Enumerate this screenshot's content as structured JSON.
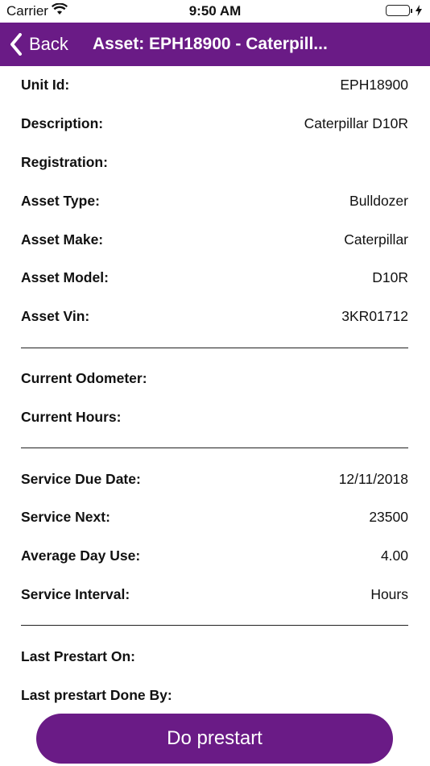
{
  "status": {
    "carrier": "Carrier",
    "time": "9:50 AM"
  },
  "nav": {
    "back_label": "Back",
    "title": "Asset: EPH18900 - Caterpill..."
  },
  "sections": [
    [
      {
        "label": "Unit Id:",
        "value": "EPH18900"
      },
      {
        "label": "Description:",
        "value": "Caterpillar D10R"
      },
      {
        "label": "Registration:",
        "value": ""
      },
      {
        "label": "Asset Type:",
        "value": "Bulldozer"
      },
      {
        "label": "Asset Make:",
        "value": "Caterpillar"
      },
      {
        "label": "Asset Model:",
        "value": "D10R"
      },
      {
        "label": "Asset Vin:",
        "value": "3KR01712"
      }
    ],
    [
      {
        "label": "Current Odometer:",
        "value": ""
      },
      {
        "label": "Current Hours:",
        "value": ""
      }
    ],
    [
      {
        "label": "Service Due Date:",
        "value": "12/11/2018"
      },
      {
        "label": "Service Next:",
        "value": "23500"
      },
      {
        "label": "Average Day Use:",
        "value": "4.00"
      },
      {
        "label": "Service Interval:",
        "value": "Hours"
      }
    ],
    [
      {
        "label": "Last Prestart On:",
        "value": ""
      },
      {
        "label": "Last prestart Done By:",
        "value": ""
      }
    ]
  ],
  "action": {
    "label": "Do prestart"
  },
  "colors": {
    "accent": "#6a1b86",
    "battery": "#4cd964"
  },
  "icons": {
    "back": "chevron-left-icon",
    "wifi": "wifi-icon",
    "battery": "battery-icon",
    "charging": "bolt-icon"
  }
}
